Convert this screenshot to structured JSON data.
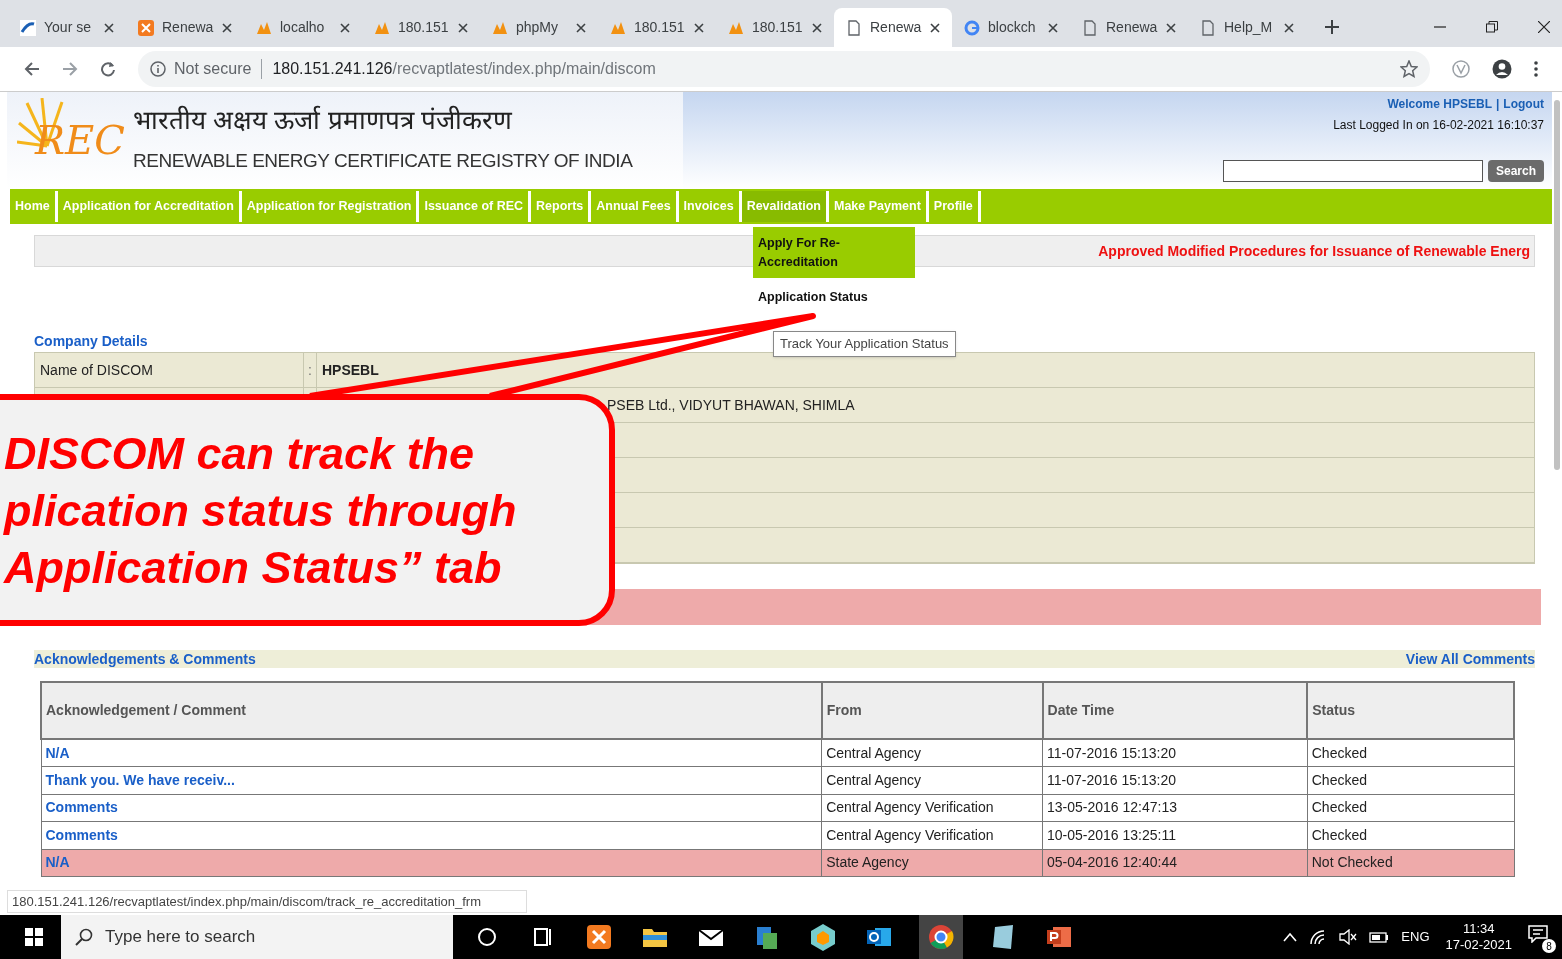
{
  "browser": {
    "tabs": [
      {
        "label": "Your se",
        "selected": false
      },
      {
        "label": "Renewa",
        "selected": false
      },
      {
        "label": "localho",
        "selected": false
      },
      {
        "label": "180.151",
        "selected": false
      },
      {
        "label": "phpMy",
        "selected": false
      },
      {
        "label": "180.151",
        "selected": false
      },
      {
        "label": "180.151",
        "selected": false
      },
      {
        "label": "Renewa",
        "selected": true
      },
      {
        "label": "blockch",
        "selected": false
      },
      {
        "label": "Renewa",
        "selected": false
      },
      {
        "label": "Help_M",
        "selected": false
      }
    ],
    "security": "Not secure",
    "url_host": "180.151.241.126",
    "url_path": "/recvaptlatest/index.php/main/discom"
  },
  "header": {
    "hindi_title": "भारतीय अक्षय ऊर्जा प्रमाणपत्र पंजीकरण",
    "english_title": "RENEWABLE ENERGY CERTIFICATE REGISTRY OF INDIA",
    "logo_text": "REC",
    "welcome": "Welcome HPSEBL",
    "separator": "|",
    "logout": "Logout",
    "last_login": "Last Logged In on 16-02-2021 16:10:37",
    "search_button": "Search"
  },
  "menu": [
    {
      "label": "Home",
      "selected": false
    },
    {
      "label": "Application for Accreditation",
      "selected": false
    },
    {
      "label": "Application for Registration",
      "selected": false
    },
    {
      "label": "Issuance of REC",
      "selected": false
    },
    {
      "label": "Reports",
      "selected": false
    },
    {
      "label": "Annual Fees",
      "selected": false
    },
    {
      "label": "Invoices",
      "selected": false
    },
    {
      "label": "Revalidation",
      "selected": true
    },
    {
      "label": "Make Payment",
      "selected": false
    },
    {
      "label": "Profile",
      "selected": false
    }
  ],
  "dropdown": [
    {
      "label": "Apply For Re-Accreditation",
      "selected": true
    },
    {
      "label": "Application Status",
      "selected": false
    }
  ],
  "tooltip": "Track Your Application Status",
  "notice": "Approved Modified Procedures for Issuance of Renewable Energ",
  "company_details": {
    "title": "Company Details",
    "rows": [
      {
        "label": "Name of DISCOM",
        "separator": ":",
        "value": "HPSEBL"
      },
      {
        "value": "PSEB Ltd., VIDYUT BHAWAN, SHIMLA"
      }
    ]
  },
  "acknowledgements": {
    "title": "Acknowledgements & Comments",
    "view_all": "View All Comments",
    "columns": [
      "Acknowledgement / Comment",
      "From",
      "Date Time",
      "Status"
    ],
    "rows": [
      {
        "comment": "N/A",
        "from": "Central Agency",
        "date_time": "11-07-2016 15:13:20",
        "status": "Checked",
        "highlighted": false
      },
      {
        "comment": "Thank you. We have receiv...",
        "from": "Central Agency",
        "date_time": "11-07-2016 15:13:20",
        "status": "Checked",
        "highlighted": false
      },
      {
        "comment": "Comments",
        "from": "Central Agency Verification",
        "date_time": "13-05-2016 12:47:13",
        "status": "Checked",
        "highlighted": false
      },
      {
        "comment": "Comments",
        "from": "Central Agency Verification",
        "date_time": "10-05-2016 13:25:11",
        "status": "Checked",
        "highlighted": false
      },
      {
        "comment": "N/A",
        "from": "State Agency",
        "date_time": "05-04-2016 12:40:44",
        "status": "Not Checked",
        "highlighted": true
      }
    ]
  },
  "link_preview": "180.151.241.126/recvaptlatest/index.php/main/discom/track_re_accreditation_frm",
  "callout": {
    "lines": [
      "DISCOM can track the",
      "plication status through",
      "Application Status” tab"
    ]
  },
  "taskbar": {
    "search_placeholder": "Type here to search",
    "language": "ENG",
    "time": "11:34",
    "date": "17-02-2021",
    "notifications": "8"
  }
}
